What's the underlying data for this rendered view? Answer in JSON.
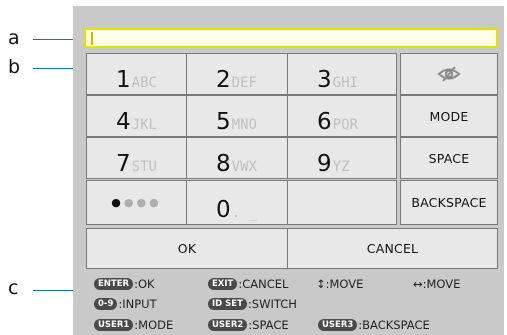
{
  "callouts": [
    "a",
    "b",
    "c"
  ],
  "input": {
    "value": ""
  },
  "keypad": {
    "rows": [
      [
        {
          "digit": "1",
          "letters": "ABC"
        },
        {
          "digit": "2",
          "letters": "DEF"
        },
        {
          "digit": "3",
          "letters": "GHI"
        }
      ],
      [
        {
          "digit": "4",
          "letters": "JKL"
        },
        {
          "digit": "5",
          "letters": "MNO"
        },
        {
          "digit": "6",
          "letters": "PQR"
        }
      ],
      [
        {
          "digit": "7",
          "letters": "STU"
        },
        {
          "digit": "8",
          "letters": "VWX"
        },
        {
          "digit": "9",
          "letters": "YZ"
        }
      ]
    ],
    "zero": {
      "digit": "0",
      "letters": ". _"
    },
    "dots": {
      "filled": 1,
      "total": 4
    }
  },
  "side_keys": {
    "mode": "MODE",
    "space": "SPACE",
    "backspace": "BACKSPACE"
  },
  "bottom": {
    "ok": "OK",
    "cancel": "CANCEL"
  },
  "help": {
    "enter": {
      "badge": "ENTER",
      "text": ":OK"
    },
    "exit": {
      "badge": "EXIT",
      "text": ":CANCEL"
    },
    "move_ud": {
      "text": "↕:MOVE"
    },
    "move_lr": {
      "text": "↔:MOVE"
    },
    "input": {
      "badge": "0-9",
      "text": ":INPUT"
    },
    "switch": {
      "badge": "ID SET",
      "text": ":SWITCH"
    },
    "user1": {
      "badge": "USER1",
      "text": ":MODE"
    },
    "user2": {
      "badge": "USER2",
      "text": ":SPACE"
    },
    "user3": {
      "badge": "USER3",
      "text": ":BACKSPACE"
    }
  },
  "colors": {
    "highlight": "#e8e000",
    "key_bg": "#e8e8e8",
    "panel_bg": "#c9c9c9",
    "callout_line": "#1c6fb3"
  }
}
